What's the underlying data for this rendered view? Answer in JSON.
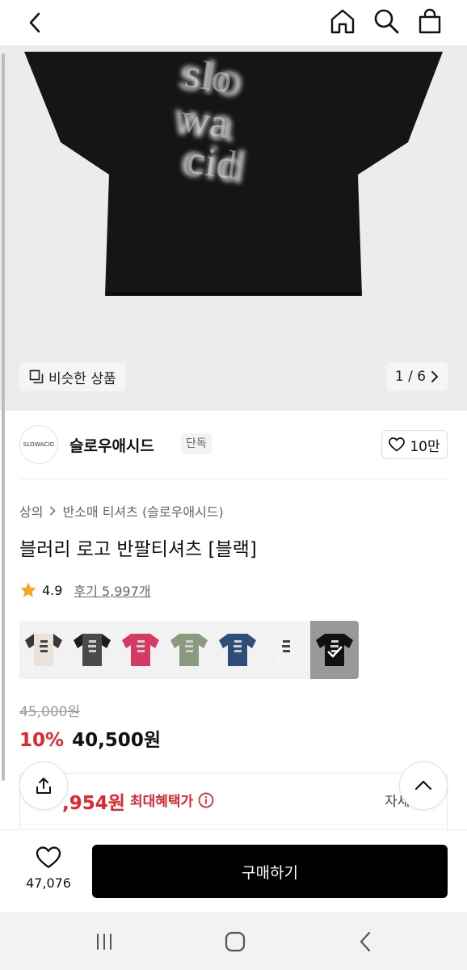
{
  "header": {
    "back_icon": "chevron-left-icon",
    "home_icon": "home-icon",
    "search_icon": "search-icon",
    "cart_icon": "shopping-bag-icon"
  },
  "gallery": {
    "similar_label": "비슷한 상품",
    "page_indicator": "1 / 6",
    "shirt_color": "#151515",
    "logo_text": "slowacid"
  },
  "brand": {
    "logo_text": "SLOWACID",
    "name": "슬로우애시드",
    "tag": "단독",
    "like_count": "10만"
  },
  "product": {
    "breadcrumb": [
      "상의",
      "반소매 티셔츠 (슬로우애시드)"
    ],
    "title": "블러리 로고 반팔티셔츠 [블랙]",
    "rating": "4.9",
    "reviews": "후기 5,997개",
    "swatches": [
      {
        "name": "ivory-raglan",
        "body": "#e9e3dc",
        "sleeve": "#3c3633"
      },
      {
        "name": "charcoal-raglan",
        "body": "#4a4a4a",
        "sleeve": "#1d1d1d"
      },
      {
        "name": "pink",
        "body": "#d43a62",
        "sleeve": "#d43a62"
      },
      {
        "name": "khaki",
        "body": "#8a9a7e",
        "sleeve": "#8a9a7e"
      },
      {
        "name": "navy",
        "body": "#2e4d79",
        "sleeve": "#2e4d79"
      },
      {
        "name": "white",
        "body": "#f4f4f4",
        "sleeve": "#f4f4f4"
      },
      {
        "name": "black",
        "body": "#111111",
        "sleeve": "#111111"
      }
    ],
    "selected_swatch": 6
  },
  "pricing": {
    "original": "45,000원",
    "discount": "10%",
    "price": "40,500원",
    "benefit_price": ",954원",
    "benefit_label": "최대혜택가",
    "detail": "자세히",
    "accent": "#e0262d"
  },
  "bottom": {
    "wish_count": "47,076",
    "buy_label": "구매하기"
  }
}
